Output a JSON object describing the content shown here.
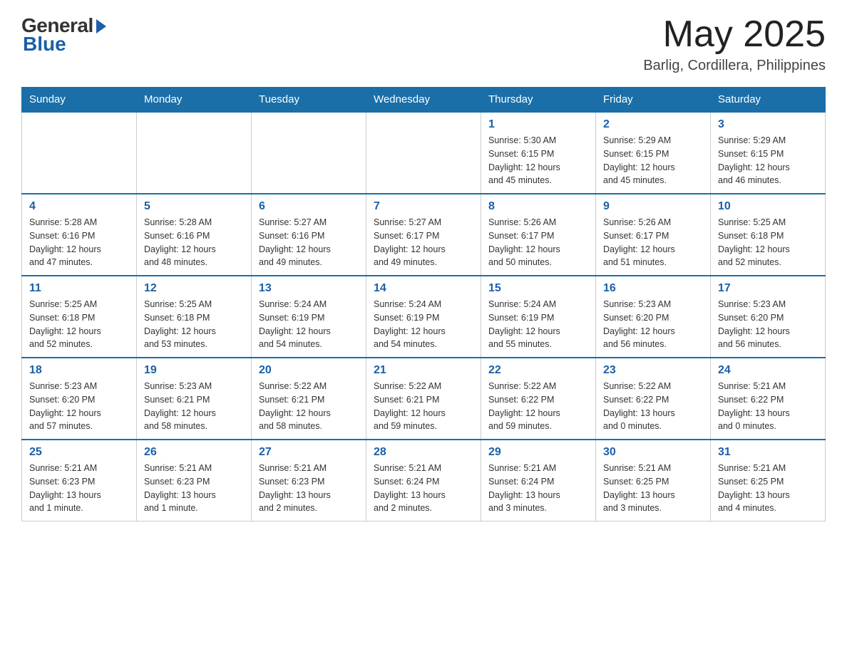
{
  "header": {
    "logo_general": "General",
    "logo_blue": "Blue",
    "month_title": "May 2025",
    "location": "Barlig, Cordillera, Philippines"
  },
  "days_of_week": [
    "Sunday",
    "Monday",
    "Tuesday",
    "Wednesday",
    "Thursday",
    "Friday",
    "Saturday"
  ],
  "weeks": [
    [
      {
        "day": "",
        "info": ""
      },
      {
        "day": "",
        "info": ""
      },
      {
        "day": "",
        "info": ""
      },
      {
        "day": "",
        "info": ""
      },
      {
        "day": "1",
        "info": "Sunrise: 5:30 AM\nSunset: 6:15 PM\nDaylight: 12 hours\nand 45 minutes."
      },
      {
        "day": "2",
        "info": "Sunrise: 5:29 AM\nSunset: 6:15 PM\nDaylight: 12 hours\nand 45 minutes."
      },
      {
        "day": "3",
        "info": "Sunrise: 5:29 AM\nSunset: 6:15 PM\nDaylight: 12 hours\nand 46 minutes."
      }
    ],
    [
      {
        "day": "4",
        "info": "Sunrise: 5:28 AM\nSunset: 6:16 PM\nDaylight: 12 hours\nand 47 minutes."
      },
      {
        "day": "5",
        "info": "Sunrise: 5:28 AM\nSunset: 6:16 PM\nDaylight: 12 hours\nand 48 minutes."
      },
      {
        "day": "6",
        "info": "Sunrise: 5:27 AM\nSunset: 6:16 PM\nDaylight: 12 hours\nand 49 minutes."
      },
      {
        "day": "7",
        "info": "Sunrise: 5:27 AM\nSunset: 6:17 PM\nDaylight: 12 hours\nand 49 minutes."
      },
      {
        "day": "8",
        "info": "Sunrise: 5:26 AM\nSunset: 6:17 PM\nDaylight: 12 hours\nand 50 minutes."
      },
      {
        "day": "9",
        "info": "Sunrise: 5:26 AM\nSunset: 6:17 PM\nDaylight: 12 hours\nand 51 minutes."
      },
      {
        "day": "10",
        "info": "Sunrise: 5:25 AM\nSunset: 6:18 PM\nDaylight: 12 hours\nand 52 minutes."
      }
    ],
    [
      {
        "day": "11",
        "info": "Sunrise: 5:25 AM\nSunset: 6:18 PM\nDaylight: 12 hours\nand 52 minutes."
      },
      {
        "day": "12",
        "info": "Sunrise: 5:25 AM\nSunset: 6:18 PM\nDaylight: 12 hours\nand 53 minutes."
      },
      {
        "day": "13",
        "info": "Sunrise: 5:24 AM\nSunset: 6:19 PM\nDaylight: 12 hours\nand 54 minutes."
      },
      {
        "day": "14",
        "info": "Sunrise: 5:24 AM\nSunset: 6:19 PM\nDaylight: 12 hours\nand 54 minutes."
      },
      {
        "day": "15",
        "info": "Sunrise: 5:24 AM\nSunset: 6:19 PM\nDaylight: 12 hours\nand 55 minutes."
      },
      {
        "day": "16",
        "info": "Sunrise: 5:23 AM\nSunset: 6:20 PM\nDaylight: 12 hours\nand 56 minutes."
      },
      {
        "day": "17",
        "info": "Sunrise: 5:23 AM\nSunset: 6:20 PM\nDaylight: 12 hours\nand 56 minutes."
      }
    ],
    [
      {
        "day": "18",
        "info": "Sunrise: 5:23 AM\nSunset: 6:20 PM\nDaylight: 12 hours\nand 57 minutes."
      },
      {
        "day": "19",
        "info": "Sunrise: 5:23 AM\nSunset: 6:21 PM\nDaylight: 12 hours\nand 58 minutes."
      },
      {
        "day": "20",
        "info": "Sunrise: 5:22 AM\nSunset: 6:21 PM\nDaylight: 12 hours\nand 58 minutes."
      },
      {
        "day": "21",
        "info": "Sunrise: 5:22 AM\nSunset: 6:21 PM\nDaylight: 12 hours\nand 59 minutes."
      },
      {
        "day": "22",
        "info": "Sunrise: 5:22 AM\nSunset: 6:22 PM\nDaylight: 12 hours\nand 59 minutes."
      },
      {
        "day": "23",
        "info": "Sunrise: 5:22 AM\nSunset: 6:22 PM\nDaylight: 13 hours\nand 0 minutes."
      },
      {
        "day": "24",
        "info": "Sunrise: 5:21 AM\nSunset: 6:22 PM\nDaylight: 13 hours\nand 0 minutes."
      }
    ],
    [
      {
        "day": "25",
        "info": "Sunrise: 5:21 AM\nSunset: 6:23 PM\nDaylight: 13 hours\nand 1 minute."
      },
      {
        "day": "26",
        "info": "Sunrise: 5:21 AM\nSunset: 6:23 PM\nDaylight: 13 hours\nand 1 minute."
      },
      {
        "day": "27",
        "info": "Sunrise: 5:21 AM\nSunset: 6:23 PM\nDaylight: 13 hours\nand 2 minutes."
      },
      {
        "day": "28",
        "info": "Sunrise: 5:21 AM\nSunset: 6:24 PM\nDaylight: 13 hours\nand 2 minutes."
      },
      {
        "day": "29",
        "info": "Sunrise: 5:21 AM\nSunset: 6:24 PM\nDaylight: 13 hours\nand 3 minutes."
      },
      {
        "day": "30",
        "info": "Sunrise: 5:21 AM\nSunset: 6:25 PM\nDaylight: 13 hours\nand 3 minutes."
      },
      {
        "day": "31",
        "info": "Sunrise: 5:21 AM\nSunset: 6:25 PM\nDaylight: 13 hours\nand 4 minutes."
      }
    ]
  ]
}
